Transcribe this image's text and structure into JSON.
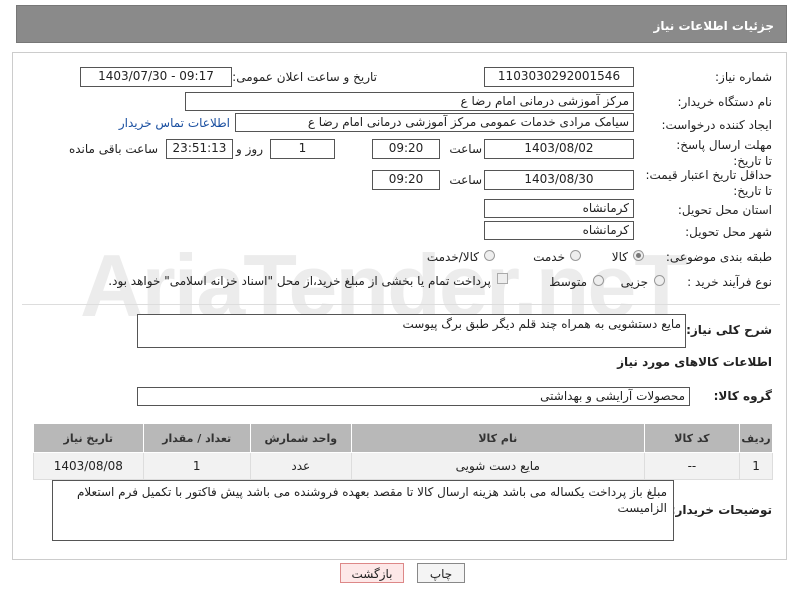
{
  "header": {
    "title": "جزئیات اطلاعات نیاز"
  },
  "fields": {
    "need_number_label": "شماره نیاز:",
    "need_number": "1103030292001546",
    "announce_label": "تاریخ و ساعت اعلان عمومی:",
    "announce_value": "1403/07/30 - 09:17",
    "buyer_org_label": "نام دستگاه خریدار:",
    "buyer_org": "مرکز آموزشی  درمانی امام رضا  ع",
    "creator_label": "ایجاد کننده درخواست:",
    "creator": "سیامک مرادی خدمات عمومی مرکز آموزشی  درمانی امام رضا  ع",
    "contact_link": "اطلاعات تماس خریدار",
    "reply_deadline_label": "مهلت ارسال پاسخ: تا تاریخ:",
    "reply_date": "1403/08/02",
    "time_label": "ساعت",
    "reply_time": "09:20",
    "days_value": "1",
    "days_label": "روز و",
    "remaining_time": "23:51:13",
    "remaining_label": "ساعت باقی مانده",
    "price_validity_label": "حداقل تاریخ اعتبار قیمت: تا تاریخ:",
    "price_date": "1403/08/30",
    "price_time": "09:20",
    "province_label": "استان محل تحویل:",
    "province": "کرمانشاه",
    "city_label": "شهر محل تحویل:",
    "city": "کرمانشاه",
    "category_label": "طبقه بندی موضوعی:",
    "category_options": [
      "کالا",
      "خدمت",
      "کالا/خدمت"
    ],
    "category_selected": "کالا",
    "process_label": "نوع فرآیند خرید :",
    "process_options": [
      "جزیی",
      "متوسط"
    ],
    "payment_note": "پرداخت تمام یا بخشی از مبلغ خرید،از محل \"اسناد خزانه اسلامی\" خواهد بود."
  },
  "description": {
    "label": "شرح کلی نیاز:",
    "value": "مایع دستشویی به همراه چند قلم دیگر طبق برگ پیوست"
  },
  "goods_section": {
    "title": "اطلاعات کالاهای مورد نیاز",
    "group_label": "گروه کالا:",
    "group_value": "محصولات آرایشی و بهداشتی"
  },
  "table": {
    "headers": [
      "ردیف",
      "کد کالا",
      "نام کالا",
      "واحد شمارش",
      "تعداد / مقدار",
      "تاریخ نیاز"
    ],
    "rows": [
      [
        "1",
        "--",
        "مایع دست شویی",
        "عدد",
        "1",
        "1403/08/08"
      ]
    ]
  },
  "buyer_notes": {
    "label": "توضیحات خریدار:",
    "value": "مبلغ باز پرداخت یکساله می باشد هزینه ارسال کالا تا مقصد بعهده فروشنده می باشد پیش فاکتور با تکمیل فرم استعلام الزامیست"
  },
  "buttons": {
    "print": "چاپ",
    "back": "بازگشت"
  },
  "watermark": "AriaTender.neT"
}
